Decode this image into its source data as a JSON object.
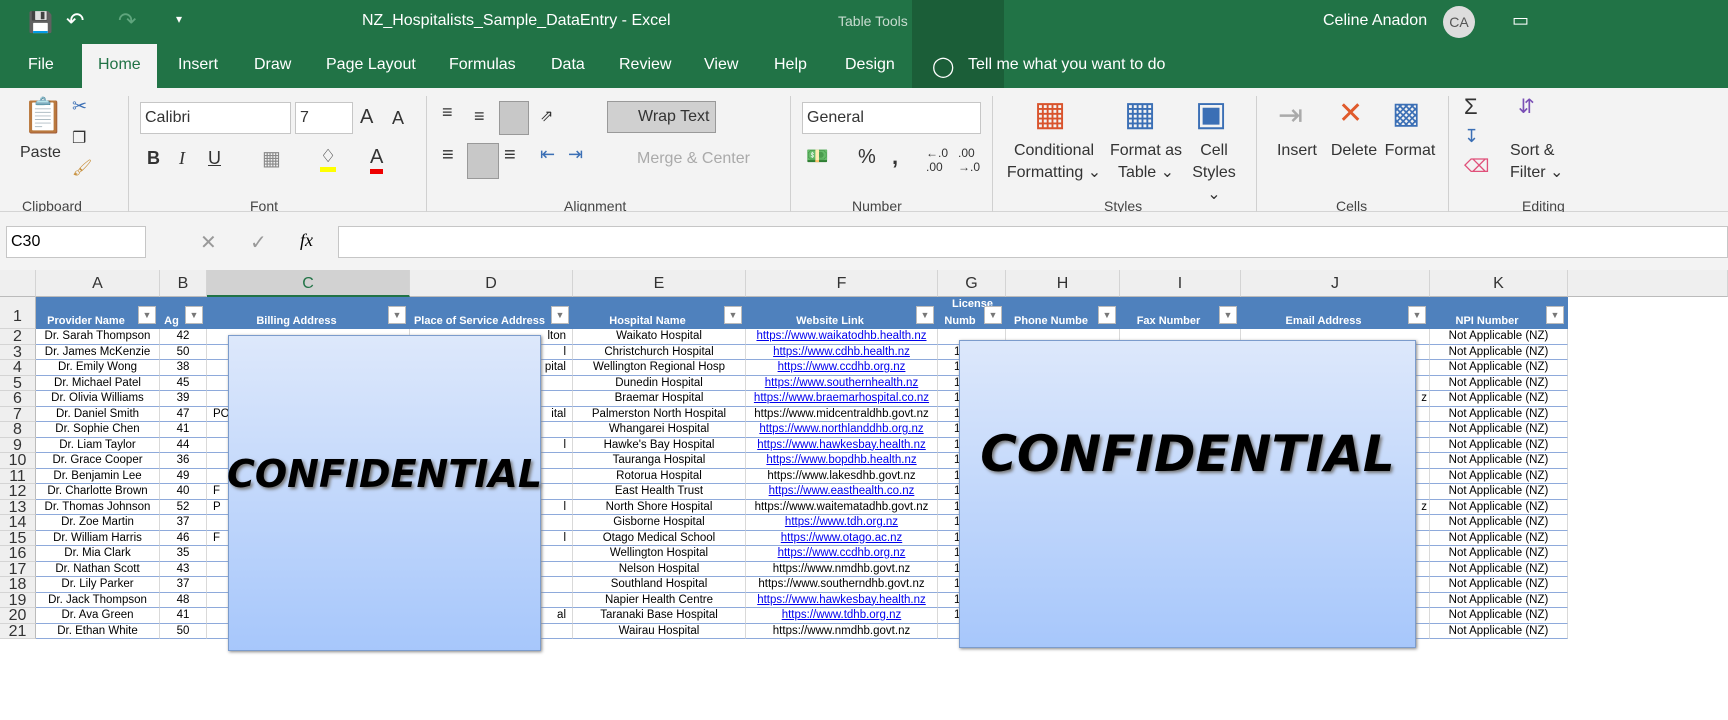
{
  "title": "NZ_Hospitalists_Sample_DataEntry  -  Excel",
  "table_tools": "Table Tools",
  "user": {
    "name": "Celine Anadon",
    "initials": "CA"
  },
  "tabs": [
    "File",
    "Home",
    "Insert",
    "Draw",
    "Page Layout",
    "Formulas",
    "Data",
    "Review",
    "View",
    "Help",
    "Design"
  ],
  "tell_me": "Tell me what you want to do",
  "ribbon": {
    "paste": "Paste",
    "font": "Calibri",
    "size": "7",
    "wrap": "Wrap Text",
    "merge": "Merge & Center",
    "number_format": "General",
    "cond1": "Conditional",
    "cond2": "Formatting",
    "fmt1": "Format as",
    "fmt2": "Table",
    "cell1": "Cell",
    "cell2": "Styles",
    "insert": "Insert",
    "delete": "Delete",
    "format": "Format",
    "sort1": "Sort &",
    "sort2": "Filter",
    "groups": [
      "Clipboard",
      "Font",
      "Alignment",
      "Number",
      "Styles",
      "Cells",
      "Editing"
    ]
  },
  "name_box": "C30",
  "columns": [
    "A",
    "B",
    "C",
    "D",
    "E",
    "F",
    "G",
    "H",
    "I",
    "J",
    "K"
  ],
  "headers": [
    "Provider Name",
    "Ag",
    "Billing Address",
    "Place of Service Address",
    "Hospital Name",
    "Website Link",
    "Numb",
    "Phone Numbe",
    "Fax Number",
    "Email Address",
    "NPI Number"
  ],
  "license_top": "License",
  "rows": [
    {
      "a": "Dr. Sarah Thompson",
      "b": "42",
      "d": "lton",
      "e": "Waikato Hospital",
      "f": "https://www.waikatodhb.health.nz",
      "link": true,
      "k": "Not Applicable (NZ)"
    },
    {
      "a": "Dr. James McKenzie",
      "b": "50",
      "d": "l",
      "e": "Christchurch Hospital",
      "f": "https://www.cdhb.health.nz",
      "link": true,
      "k": "Not Applicable (NZ)",
      "g": "1"
    },
    {
      "a": "Dr. Emily Wong",
      "b": "38",
      "d": "pital",
      "e": "Wellington Regional Hosp",
      "f": "https://www.ccdhb.org.nz",
      "link": true,
      "k": "Not Applicable (NZ)",
      "g": "1"
    },
    {
      "a": "Dr. Michael Patel",
      "b": "45",
      "e": "Dunedin Hospital",
      "f": "https://www.southernhealth.nz",
      "link": true,
      "k": "Not Applicable (NZ)",
      "g": "1"
    },
    {
      "a": "Dr. Olivia Williams",
      "b": "39",
      "e": "Braemar Hospital",
      "f": "https://www.braemarhospital.co.nz",
      "link": true,
      "k": "Not Applicable (NZ)",
      "g": "1",
      "j": "z"
    },
    {
      "a": "Dr. Daniel Smith",
      "b": "47",
      "c": "PO",
      "d": "ital",
      "e": "Palmerston North Hospital",
      "f": "https://www.midcentraldhb.govt.nz",
      "link": false,
      "k": "Not Applicable (NZ)",
      "g": "1"
    },
    {
      "a": "Dr. Sophie Chen",
      "b": "41",
      "e": "Whangarei Hospital",
      "f": "https://www.northlanddhb.org.nz",
      "link": true,
      "k": "Not Applicable (NZ)",
      "g": "1"
    },
    {
      "a": "Dr. Liam Taylor",
      "b": "44",
      "d": "l",
      "e": "Hawke's Bay Hospital",
      "f": "https://www.hawkesbay.health.nz",
      "link": true,
      "k": "Not Applicable (NZ)",
      "g": "1"
    },
    {
      "a": "Dr. Grace Cooper",
      "b": "36",
      "e": "Tauranga Hospital",
      "f": "https://www.bopdhb.health.nz",
      "link": true,
      "k": "Not Applicable (NZ)",
      "g": "1"
    },
    {
      "a": "Dr. Benjamin Lee",
      "b": "49",
      "e": "Rotorua Hospital",
      "f": "https://www.lakesdhb.govt.nz",
      "link": false,
      "k": "Not Applicable (NZ)",
      "g": "1"
    },
    {
      "a": "Dr. Charlotte Brown",
      "b": "40",
      "c": "F",
      "e": "East Health Trust",
      "f": "https://www.easthealth.co.nz",
      "link": true,
      "k": "Not Applicable (NZ)",
      "g": "1"
    },
    {
      "a": "Dr. Thomas Johnson",
      "b": "52",
      "c": "P",
      "d": "l",
      "e": "North Shore Hospital",
      "f": "https://www.waitematadhb.govt.nz",
      "link": false,
      "k": "Not Applicable (NZ)",
      "g": "1",
      "j": "z"
    },
    {
      "a": "Dr. Zoe Martin",
      "b": "37",
      "e": "Gisborne Hospital",
      "f": "https://www.tdh.org.nz",
      "link": true,
      "k": "Not Applicable (NZ)",
      "g": "1"
    },
    {
      "a": "Dr. William Harris",
      "b": "46",
      "c": "F",
      "d": "l",
      "e": "Otago Medical School",
      "f": "https://www.otago.ac.nz",
      "link": true,
      "k": "Not Applicable (NZ)",
      "g": "1"
    },
    {
      "a": "Dr. Mia Clark",
      "b": "35",
      "e": "Wellington Hospital",
      "f": "https://www.ccdhb.org.nz",
      "link": true,
      "k": "Not Applicable (NZ)",
      "g": "1"
    },
    {
      "a": "Dr. Nathan Scott",
      "b": "43",
      "e": "Nelson Hospital",
      "f": "https://www.nmdhb.govt.nz",
      "link": false,
      "k": "Not Applicable (NZ)",
      "g": "1"
    },
    {
      "a": "Dr. Lily Parker",
      "b": "37",
      "e": "Southland Hospital",
      "f": "https://www.southerndhb.govt.nz",
      "link": false,
      "k": "Not Applicable (NZ)",
      "g": "1"
    },
    {
      "a": "Dr. Jack Thompson",
      "b": "48",
      "e": "Napier Health Centre",
      "f": "https://www.hawkesbay.health.nz",
      "link": true,
      "k": "Not Applicable (NZ)",
      "g": "1"
    },
    {
      "a": "Dr. Ava Green",
      "b": "41",
      "d": "al",
      "e": "Taranaki Base Hospital",
      "f": "https://www.tdhb.org.nz",
      "link": true,
      "k": "Not Applicable (NZ)",
      "g": "1"
    },
    {
      "a": "Dr. Ethan White",
      "b": "50",
      "e": "Wairau Hospital",
      "f": "https://www.nmdhb.govt.nz",
      "link": false,
      "k": "Not Applicable (NZ)"
    }
  ],
  "overlay_text": "CONFIDENTIAL",
  "colors": {
    "brand": "#217346",
    "table_header": "#4f81bd"
  }
}
